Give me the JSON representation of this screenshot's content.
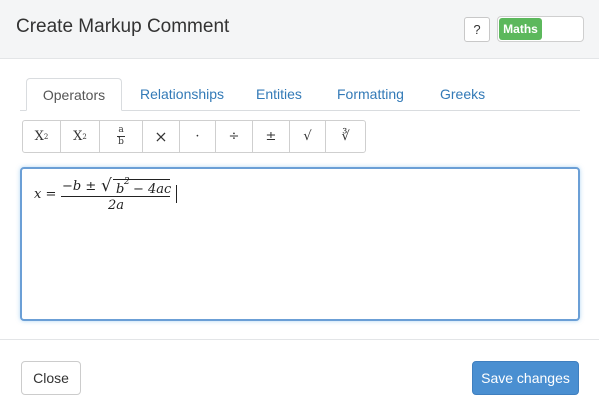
{
  "dialog": {
    "title": "Create Markup Comment"
  },
  "header": {
    "help_label": "?",
    "maths_toggle_label": "Maths",
    "maths_enabled": true
  },
  "tabs": [
    {
      "label": "Operators",
      "active": true
    },
    {
      "label": "Relationships",
      "active": false
    },
    {
      "label": "Entities",
      "active": false
    },
    {
      "label": "Formatting",
      "active": false
    },
    {
      "label": "Greeks",
      "active": false
    }
  ],
  "toolbar": {
    "superscript": {
      "base": "X",
      "exp": "2"
    },
    "subscript": {
      "base": "X",
      "sub": "2"
    },
    "fraction": {
      "num": "a",
      "den": "b"
    },
    "times": "×",
    "dot": "·",
    "divide": "÷",
    "plus_minus": "±",
    "sqrt": "√",
    "cube_root": "∛"
  },
  "editor": {
    "lhs": "x =",
    "numerator_prefix": "−b ±",
    "radical": "√",
    "radicand_b": "b",
    "radicand_exp": "2",
    "radicand_rest": "− 4ac",
    "denominator": "2a"
  },
  "footer": {
    "close_label": "Close",
    "save_label": "Save changes"
  },
  "colors": {
    "toggle_on": "#5cb85c",
    "primary": "#4a8fd1",
    "link": "#337ab7"
  }
}
